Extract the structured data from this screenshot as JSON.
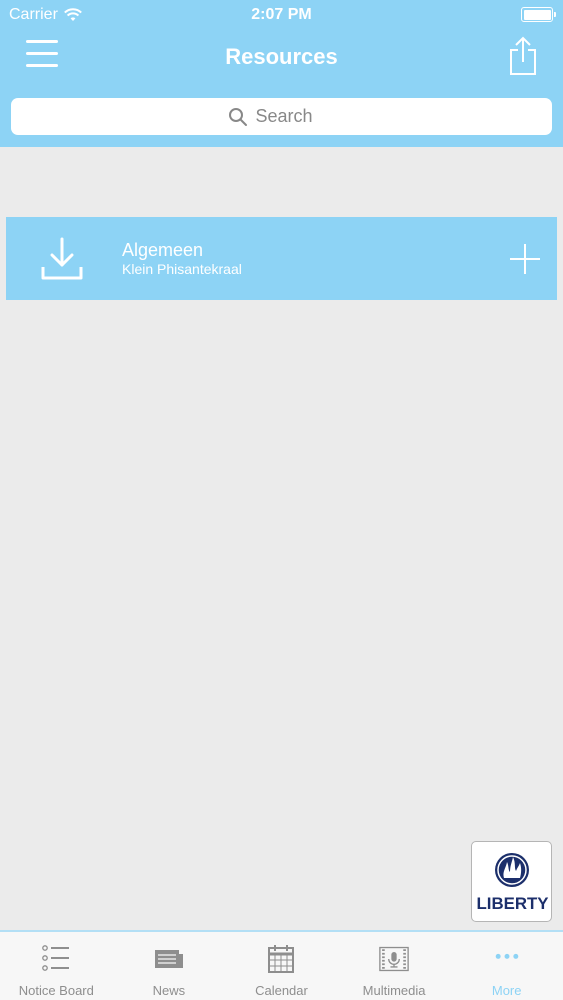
{
  "status_bar": {
    "carrier": "Carrier",
    "time": "2:07 PM"
  },
  "nav": {
    "title": "Resources"
  },
  "search": {
    "placeholder": "Search"
  },
  "resources": [
    {
      "title": "Algemeen",
      "subtitle": "Klein Phisantekraal"
    }
  ],
  "sponsor": {
    "name": "LIBERTY"
  },
  "tabs": [
    {
      "label": "Notice Board",
      "icon": "list-icon"
    },
    {
      "label": "News",
      "icon": "news-icon"
    },
    {
      "label": "Calendar",
      "icon": "calendar-icon"
    },
    {
      "label": "Multimedia",
      "icon": "multimedia-icon"
    },
    {
      "label": "More",
      "icon": "more-icon",
      "active": true
    }
  ],
  "colors": {
    "accent": "#8dd3f5",
    "background": "#ebebeb",
    "tab_inactive": "#8e8e8e",
    "logo_navy": "#1c2f6b"
  }
}
